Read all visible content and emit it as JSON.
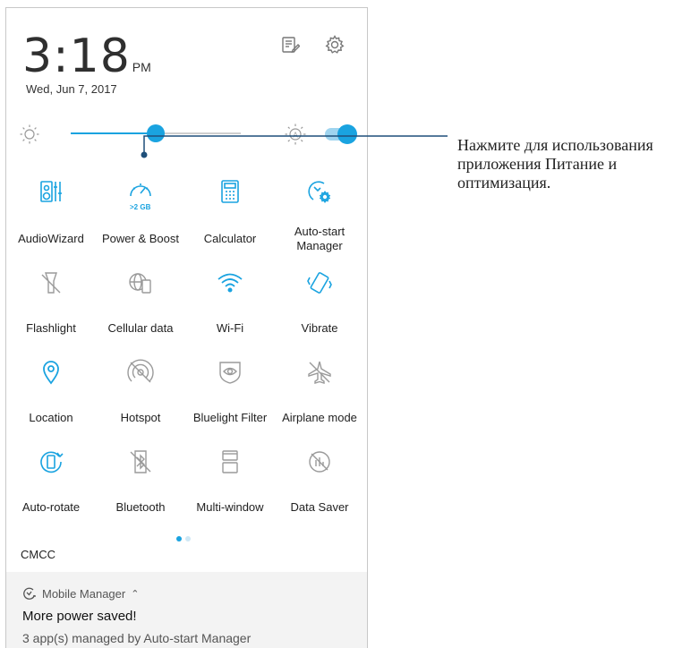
{
  "status": {
    "time": "3:18",
    "ampm": "PM",
    "date": "Wed, Jun 7, 2017"
  },
  "top_icons": [
    "notes-icon",
    "gear-icon"
  ],
  "brightness": {
    "level": 0.5,
    "auto_on": true
  },
  "tiles": [
    {
      "label": "AudioWizard",
      "icon": "audiowizard-icon",
      "active": true
    },
    {
      "label": "Power & Boost",
      "icon": "power-boost-icon",
      "active": true,
      "badge": ">2 GB"
    },
    {
      "label": "Calculator",
      "icon": "calculator-icon",
      "active": true
    },
    {
      "label": "Auto-start Manager",
      "icon": "autostart-icon",
      "active": true
    },
    {
      "label": "Flashlight",
      "icon": "flashlight-icon",
      "active": false
    },
    {
      "label": "Cellular data",
      "icon": "cellular-data-icon",
      "active": false
    },
    {
      "label": "Wi-Fi",
      "icon": "wifi-icon",
      "active": true
    },
    {
      "label": "Vibrate",
      "icon": "vibrate-icon",
      "active": true
    },
    {
      "label": "Location",
      "icon": "location-icon",
      "active": true
    },
    {
      "label": "Hotspot",
      "icon": "hotspot-icon",
      "active": false
    },
    {
      "label": "Bluelight Filter",
      "icon": "bluelight-icon",
      "active": false
    },
    {
      "label": "Airplane mode",
      "icon": "airplane-icon",
      "active": false
    },
    {
      "label": "Auto-rotate",
      "icon": "autorotate-icon",
      "active": true
    },
    {
      "label": "Bluetooth",
      "icon": "bluetooth-icon",
      "active": false
    },
    {
      "label": "Multi-window",
      "icon": "multiwindow-icon",
      "active": false
    },
    {
      "label": "Data Saver",
      "icon": "datasaver-icon",
      "active": false
    }
  ],
  "pager": {
    "current_page": 1,
    "pages": 2
  },
  "carrier": "CMCC",
  "notification": {
    "app": "Mobile Manager",
    "title": "More power saved!",
    "text": "3 app(s) managed by Auto-start Manager"
  },
  "callout": "Нажмите для использования приложения Питание и оптимизация.",
  "colors": {
    "accent": "#1aa3e0",
    "inactive_icon": "#9a9a9a",
    "text": "#222222",
    "leader": "#1f4f7a"
  }
}
